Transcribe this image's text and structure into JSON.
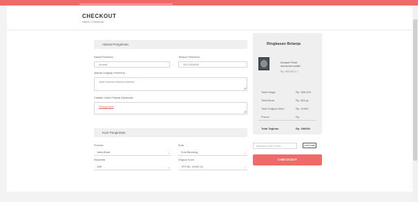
{
  "header": {
    "title": "CHECKOUT",
    "breadcrumb": "Home / Checkout"
  },
  "shipping_address": {
    "section_title": "Alamat Pengiriman",
    "recipient_name_label": "Nama Penerima",
    "recipient_name_value": "Andrea",
    "phone_label": "Telepon Penerima",
    "phone_value": "08123456655",
    "address_label": "Alamat Lengkap Penerima",
    "address_value": "Jalan sekeloa sekeloa sekeloa",
    "note_label": "Catatan Untuk Penjual (Opsional)",
    "note_value": "Tolong cepat"
  },
  "courier": {
    "section_title": "Kurir Pengiriman",
    "province_label": "Provinsi",
    "province_value": "Jawa Barat",
    "city_label": "Kota",
    "city_value": "Kota Bandung",
    "expedition_label": "Ekspedisi",
    "expedition_value": "JNE",
    "cost_label": "Ongkos Kirim",
    "cost_value": "YES Rp. 41000 (1)"
  },
  "summary": {
    "title": "Ringkasan Belanja",
    "product_name": "Dompet Pendi menepuen wallet",
    "product_price": "Rp. 355,000 x 1",
    "rows": [
      {
        "label": "Total Harga",
        "value": "Rp. 355,000"
      },
      {
        "label": "Total Berat",
        "value": "Rp. 800 gr"
      },
      {
        "label": "Total Ongkos Kirim",
        "value": "Rp. 41000"
      },
      {
        "label": "Promo",
        "value": "Rp."
      }
    ],
    "total_label": "Total Tagihan",
    "total_value": "Rp. 396000"
  },
  "promo": {
    "placeholder": "Masukan Kode Promo",
    "button_label": "Cek Kode"
  },
  "checkout_button_label": "CHECKOUT",
  "colors": {
    "accent": "#f06a6a",
    "panel": "#efefef"
  }
}
